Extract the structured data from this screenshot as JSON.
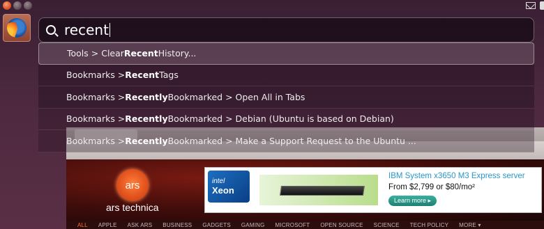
{
  "search": {
    "query": "recent"
  },
  "results": [
    {
      "prefix": "Tools > Clear ",
      "bold": "Recent",
      "suffix": " History..."
    },
    {
      "prefix": "Bookmarks > ",
      "bold": "Recent",
      "suffix": " Tags"
    },
    {
      "prefix": "Bookmarks > ",
      "bold": "Recently",
      "suffix": " Bookmarked > Open All in Tabs"
    },
    {
      "prefix": "Bookmarks > ",
      "bold": "Recently",
      "suffix": " Bookmarked > Debian (Ubuntu is based on Debian)"
    },
    {
      "prefix": "Bookmarks > ",
      "bold": "Recently",
      "suffix": " Bookmarked > Make a Support Request to the Ubuntu ..."
    }
  ],
  "ars": {
    "logo_text": "ars",
    "site_name": "ars technica",
    "ad": {
      "intel_top": "intel",
      "intel_bottom": "Xeon",
      "title": "IBM System x3650 M3 Express server",
      "price": "From $2,799 or $80/mo²",
      "button": "Learn more ▸"
    },
    "nav": [
      "ALL",
      "APPLE",
      "ASK ARS",
      "BUSINESS",
      "GADGETS",
      "GAMING",
      "MICROSOFT",
      "OPEN SOURCE",
      "SCIENCE",
      "TECH POLICY",
      "MORE ▾"
    ]
  },
  "colors": {
    "accent_orange": "#e0532a",
    "ad_link": "#2a96c8"
  }
}
